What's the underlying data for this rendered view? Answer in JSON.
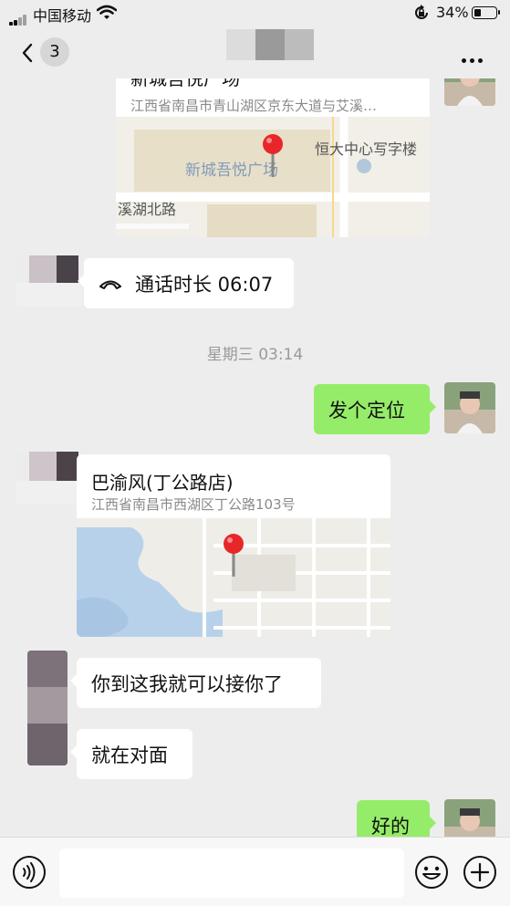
{
  "status_bar": {
    "carrier": "中国移动",
    "battery_percent": "34%",
    "battery_level": 0.34
  },
  "nav": {
    "unread_badge": "3",
    "title_blurred": true
  },
  "messages": {
    "location_1": {
      "name": "新城吾悦广场",
      "address": "江西省南昌市青山湖区京东大道与艾溪…",
      "map_labels": {
        "poi_main": "新城吾悦广场",
        "poi_tower": "恒大中心写字楼",
        "road": "溪湖北路"
      }
    },
    "call": {
      "text": "通话时长 06:07"
    },
    "timestamp": "星期三 03:14",
    "sent_1": "发个定位",
    "location_2": {
      "name": "巴渝风(丁公路店)",
      "address": "江西省南昌市西湖区丁公路103号"
    },
    "recv_1": "你到这我就可以接你了",
    "recv_2": "就在对面",
    "sent_2": "好的"
  },
  "input_bar": {
    "placeholder": ""
  },
  "colors": {
    "background": "#ededed",
    "bubble_sent": "#95ec69",
    "bubble_received": "#ffffff",
    "pin_red": "#e8262a"
  }
}
